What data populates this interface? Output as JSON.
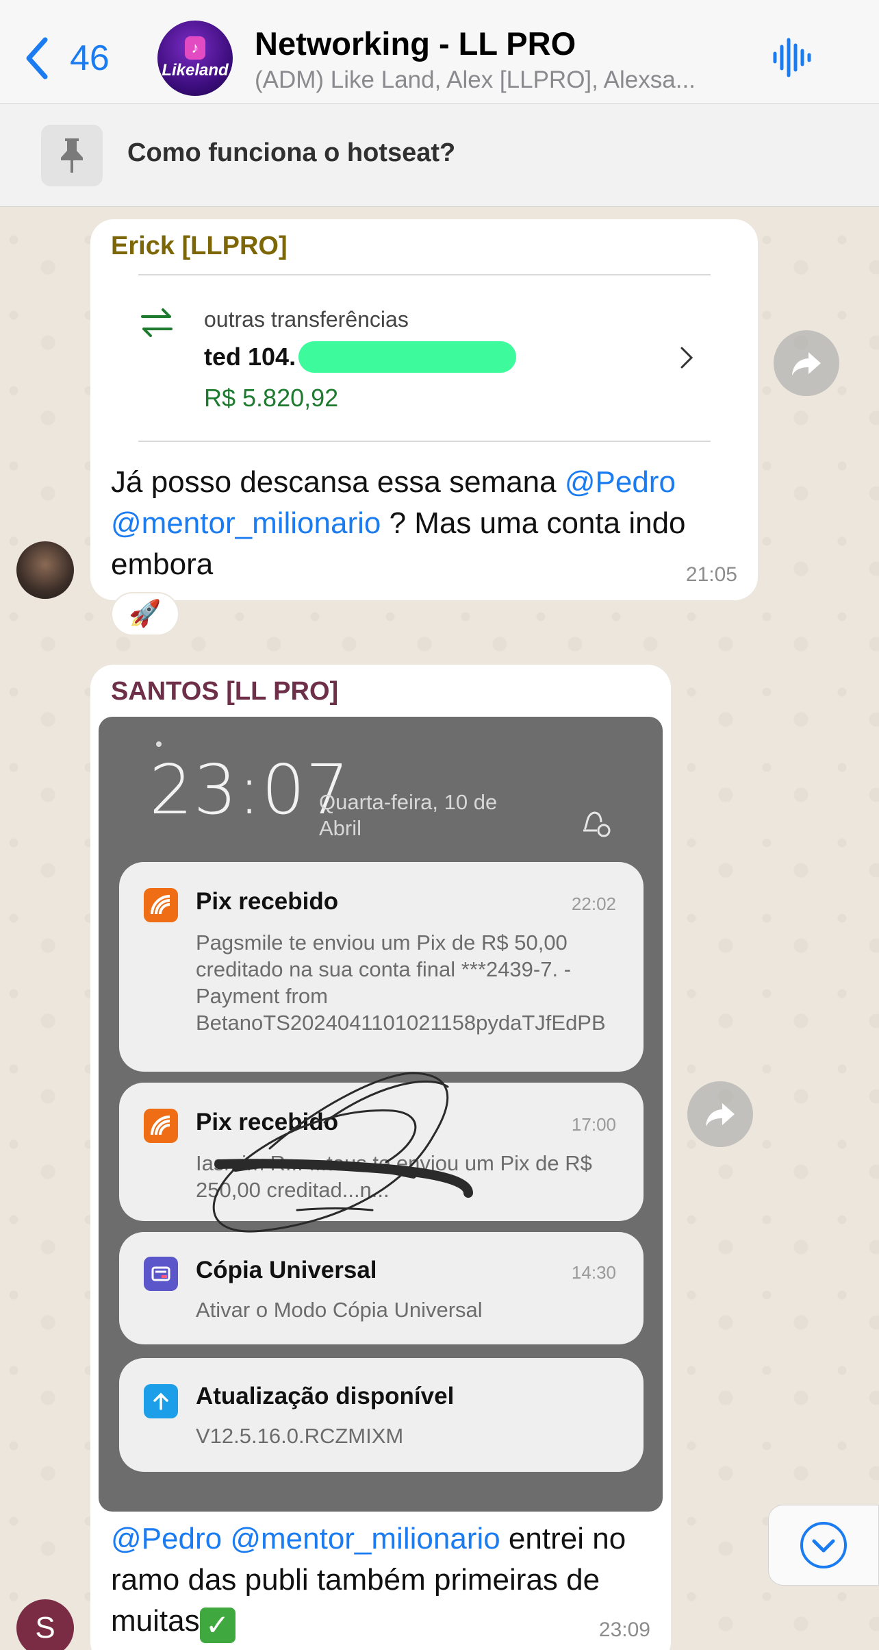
{
  "header": {
    "back_count": "46",
    "title": "Networking - LL PRO",
    "subtitle": "(ADM) Like Land, Alex [LLPRO], Alexsa...",
    "avatar_logo_text": "Likeland"
  },
  "pinned": {
    "text": "Como funciona o hotseat?"
  },
  "messages": [
    {
      "sender": "Erick [LLPRO]",
      "transaction": {
        "type": "outras transferências",
        "name": "ted 104.",
        "amount": "R$ 5.820,92"
      },
      "text_parts": {
        "a": "Já posso descansa essa semana ",
        "mention1": "@Pedro",
        "mention2": "@mentor_milionario",
        "b": " ? Mas uma conta indo embora"
      },
      "time": "21:05",
      "reaction": "🚀"
    },
    {
      "sender": "SANTOS [LL PRO]",
      "screenshot": {
        "clock": "23:07",
        "date": "Quarta-feira, 10 de Abril",
        "notifications": [
          {
            "title": "Pix recebido",
            "time": "22:02",
            "body": "Pagsmile te enviou um Pix de R$ 50,00 creditado na sua conta final ***2439-7. - Payment from BetanoTS2024041101021158pydaTJfEdPB"
          },
          {
            "title": "Pix recebido",
            "time": "17:00",
            "body": "Iasmim R... ...tous te enviou um Pix de R$ 250,00 creditad...n..."
          },
          {
            "title": "Cópia Universal",
            "time": "14:30",
            "body": "Ativar o Modo Cópia Universal"
          },
          {
            "title": "Atualização disponível",
            "time": "",
            "body": "V12.5.16.0.RCZMIXM"
          }
        ]
      },
      "text_parts": {
        "at": "@",
        "mention1": "Pedro",
        "mention2": "@mentor_milionario",
        "b": " entrei no ramo das publi também primeiras de muitas"
      },
      "time": "23:09",
      "avatar_initial": "S"
    }
  ],
  "colors": {
    "accent": "#1a7cf0",
    "erick_name": "#7d6606",
    "santos_name": "#6e3049",
    "amount_green": "#1e7a2f"
  }
}
